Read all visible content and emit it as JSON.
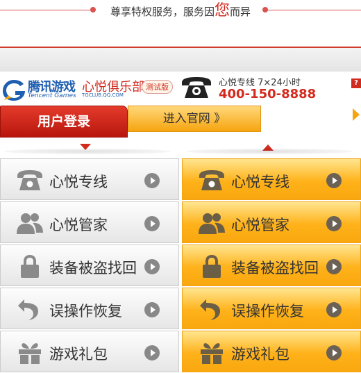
{
  "banner": {
    "slogan_pre": "尊享特权服务，服务因",
    "slogan_big": "您",
    "slogan_post": "而异"
  },
  "brand": {
    "logo_cn": "腾讯游戏",
    "logo_en": "Tencent Games",
    "club_cn": "心悦俱乐部",
    "club_en": "TGCLUB.QQ.COM",
    "beta": "测试版"
  },
  "hotline": {
    "label": "心悦专线 7×24小时",
    "number": "400-150-8888"
  },
  "help": "?",
  "nav": {
    "login": "用户登录",
    "official": "进入官网 》"
  },
  "tiles_left": [
    {
      "label": "心悦专线",
      "icon": "phone-icon"
    },
    {
      "label": "心悦管家",
      "icon": "people-icon"
    },
    {
      "label": "装备被盗找回",
      "icon": "lock-icon"
    },
    {
      "label": "误操作恢复",
      "icon": "undo-icon"
    },
    {
      "label": "游戏礼包",
      "icon": "gift-icon"
    }
  ],
  "tiles_right": [
    {
      "label": "心悦专线",
      "icon": "phone-icon"
    },
    {
      "label": "心悦管家",
      "icon": "people-icon"
    },
    {
      "label": "装备被盗找回",
      "icon": "lock-icon"
    },
    {
      "label": "误操作恢复",
      "icon": "undo-icon"
    },
    {
      "label": "游戏礼包",
      "icon": "gift-icon"
    }
  ],
  "colors": {
    "accent_red": "#d22a1e",
    "accent_orange": "#f6a40f",
    "brand_blue": "#1f5fb0"
  }
}
